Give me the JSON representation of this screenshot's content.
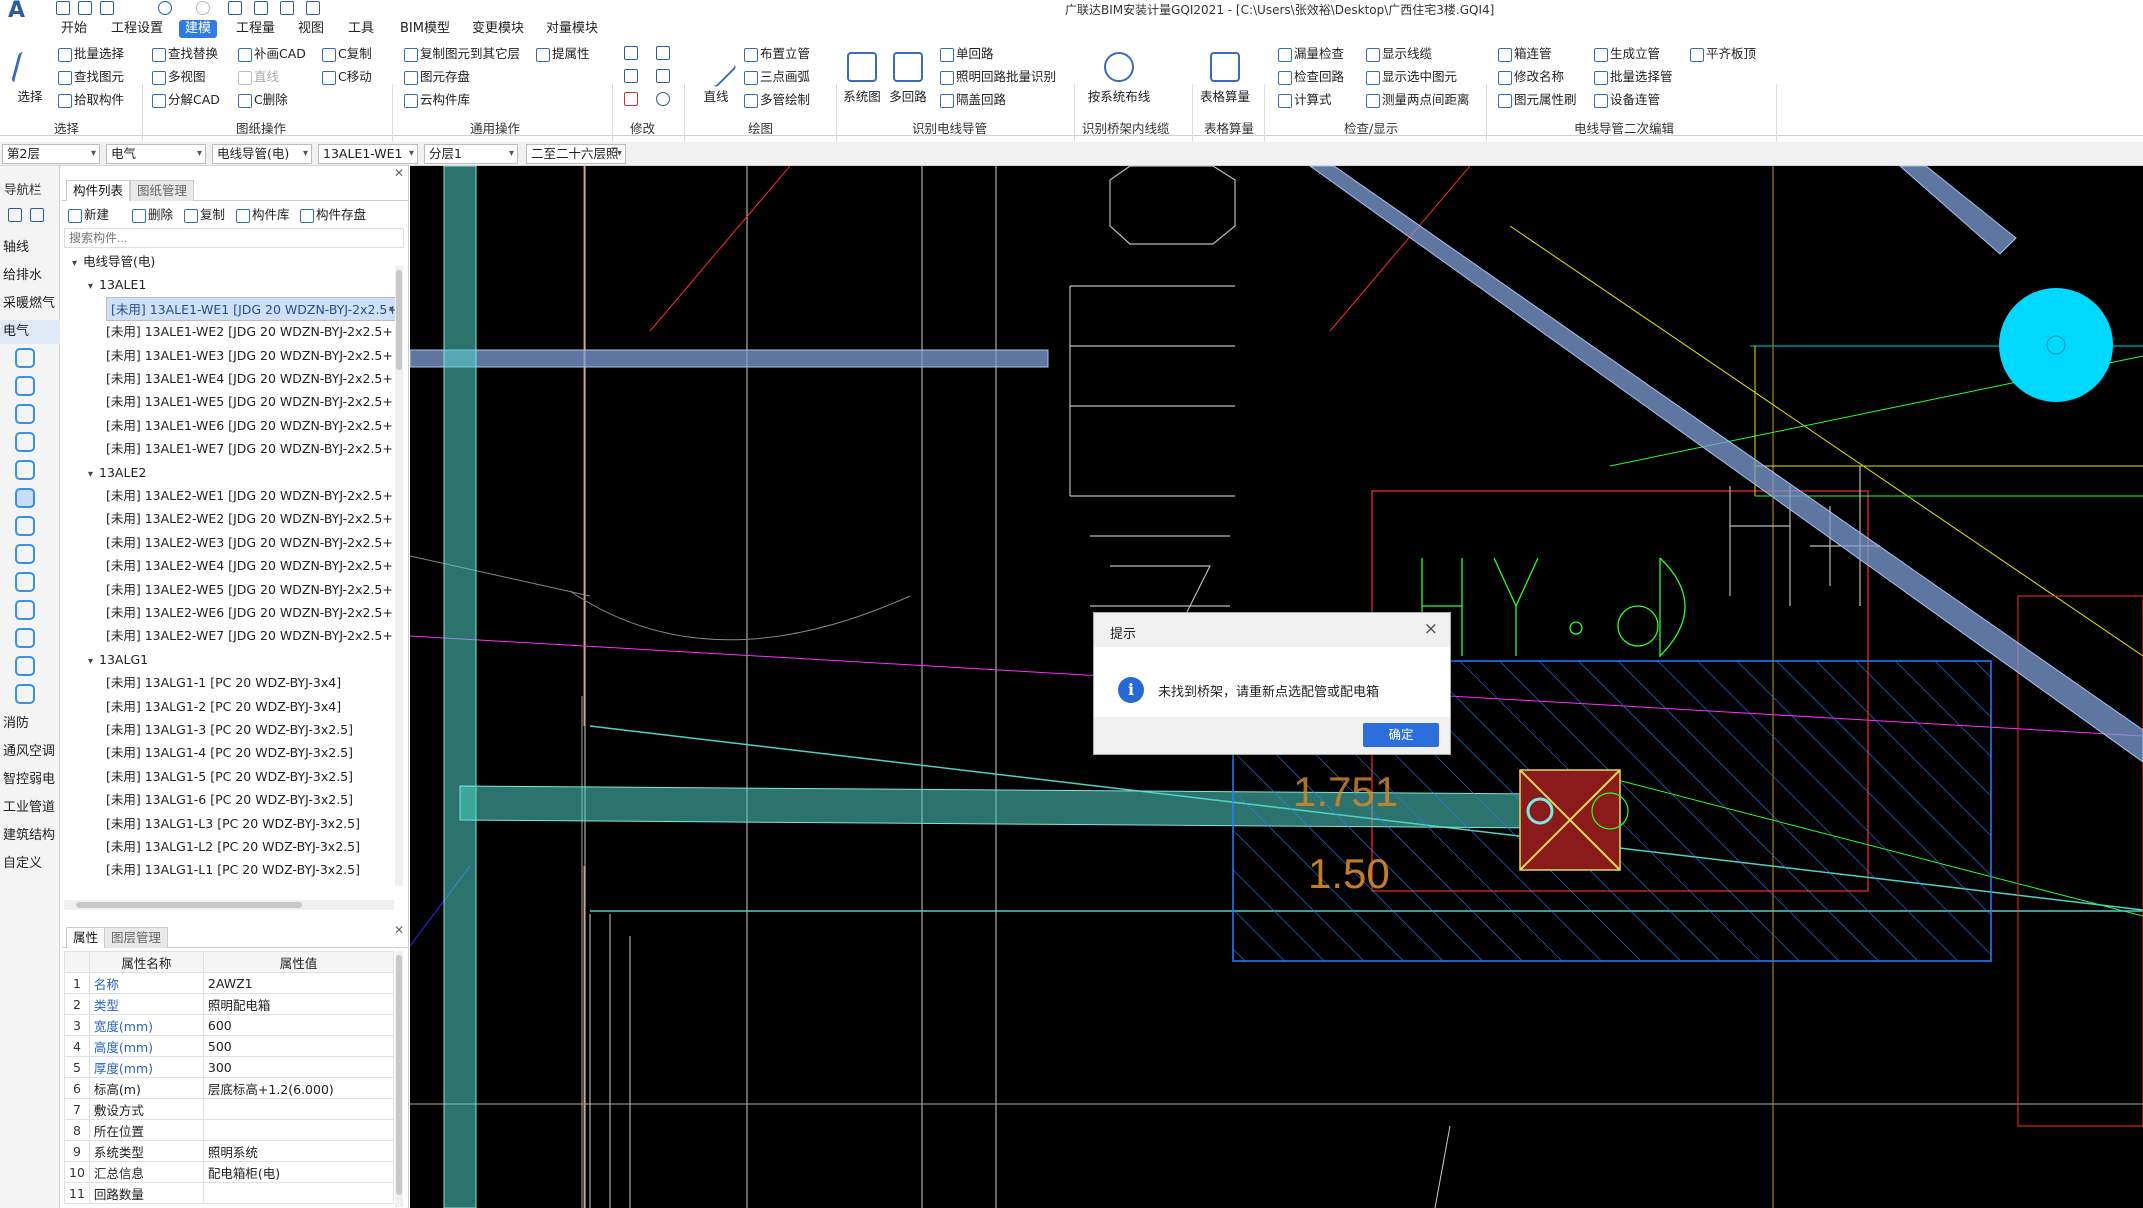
{
  "window": {
    "title": "广联达BIM安装计量GQI2021 - [C:\\Users\\张效裕\\Desktop\\广西住宅3楼.GQI4]"
  },
  "menus": [
    "开始",
    "工程设置",
    "建模",
    "工程量",
    "视图",
    "工具",
    "BIM模型",
    "变更模块",
    "对量模块"
  ],
  "ribbon": {
    "select": {
      "label": "选择",
      "items": [
        "批量选择",
        "查找图元",
        "拾取构件"
      ],
      "group": "选择"
    },
    "drawing_ops": {
      "items": [
        "查找替换",
        "多视图",
        "分解CAD",
        "补画CAD",
        "直线",
        "C复制",
        "C移动",
        "C删除"
      ],
      "group": "图纸操作"
    },
    "common_ops": {
      "items": [
        "复制图元到其它层",
        "提属性",
        "图元存盘",
        "云构件库"
      ],
      "group": "通用操作"
    },
    "modify": {
      "group": "修改"
    },
    "draw": {
      "big": "直线",
      "items": [
        "布置立管",
        "三点画弧",
        "多管绘制"
      ],
      "group": "绘图"
    },
    "identify_conduit": {
      "bigs": [
        "系统图",
        "多回路"
      ],
      "items": [
        "单回路",
        "照明回路批量识别",
        "隔盖回路"
      ],
      "group": "识别电线导管"
    },
    "identify_tray": {
      "big": "按系统布线",
      "group": "识别桥架内线缆"
    },
    "table_calc": {
      "big": "表格算量",
      "group": "表格算量"
    },
    "check_show": {
      "items": [
        "漏量检查",
        "检查回路",
        "计算式",
        "显示线缆",
        "显示选中图元",
        "测量两点间距离"
      ],
      "group": "检查/显示"
    },
    "secondary_edit": {
      "items": [
        "箱连管",
        "修改名称",
        "图元属性刷",
        "生成立管",
        "批量选择管",
        "设备连管",
        "平齐板顶"
      ],
      "group": "电线导管二次编辑"
    }
  },
  "selectors": [
    "第2层",
    "电气",
    "电线导管(电)",
    "13ALE1-WE1",
    "分层1",
    "二至二十六层照"
  ],
  "nav": {
    "title": "导航栏",
    "items": [
      "轴线",
      "给排水",
      "采暖燃气",
      "电气",
      "消防",
      "通风空调",
      "智控弱电",
      "工业管道",
      "建筑结构",
      "自定义"
    ]
  },
  "component_panel": {
    "tabs": [
      "构件列表",
      "图纸管理"
    ],
    "toolbar": [
      "新建",
      "删除",
      "复制",
      "构件库",
      "构件存盘"
    ],
    "search_placeholder": "搜索构件...",
    "tree": [
      {
        "label": "电线导管(电)",
        "level": 0,
        "header": true
      },
      {
        "label": "13ALE1",
        "level": 1,
        "header": true
      },
      {
        "label": "[未用] 13ALE1-WE1 [JDG 20 WDZN-BYJ-2x2.5+",
        "level": 2,
        "selected": true
      },
      {
        "label": "[未用] 13ALE1-WE2 [JDG 20 WDZN-BYJ-2x2.5+",
        "level": 2
      },
      {
        "label": "[未用] 13ALE1-WE3 [JDG 20 WDZN-BYJ-2x2.5+",
        "level": 2
      },
      {
        "label": "[未用] 13ALE1-WE4 [JDG 20 WDZN-BYJ-2x2.5+",
        "level": 2
      },
      {
        "label": "[未用] 13ALE1-WE5 [JDG 20 WDZN-BYJ-2x2.5+",
        "level": 2
      },
      {
        "label": "[未用] 13ALE1-WE6 [JDG 20 WDZN-BYJ-2x2.5+",
        "level": 2
      },
      {
        "label": "[未用] 13ALE1-WE7 [JDG 20 WDZN-BYJ-2x2.5+",
        "level": 2
      },
      {
        "label": "13ALE2",
        "level": 1,
        "header": true
      },
      {
        "label": "[未用] 13ALE2-WE1 [JDG 20 WDZN-BYJ-2x2.5+",
        "level": 2
      },
      {
        "label": "[未用] 13ALE2-WE2 [JDG 20 WDZN-BYJ-2x2.5+",
        "level": 2
      },
      {
        "label": "[未用] 13ALE2-WE3 [JDG 20 WDZN-BYJ-2x2.5+",
        "level": 2
      },
      {
        "label": "[未用] 13ALE2-WE4 [JDG 20 WDZN-BYJ-2x2.5+",
        "level": 2
      },
      {
        "label": "[未用] 13ALE2-WE5 [JDG 20 WDZN-BYJ-2x2.5+",
        "level": 2
      },
      {
        "label": "[未用] 13ALE2-WE6 [JDG 20 WDZN-BYJ-2x2.5+",
        "level": 2
      },
      {
        "label": "[未用] 13ALE2-WE7 [JDG 20 WDZN-BYJ-2x2.5+",
        "level": 2
      },
      {
        "label": "13ALG1",
        "level": 1,
        "header": true
      },
      {
        "label": "[未用] 13ALG1-1 [PC 20 WDZ-BYJ-3x4]",
        "level": 2
      },
      {
        "label": "[未用] 13ALG1-2 [PC 20 WDZ-BYJ-3x4]",
        "level": 2
      },
      {
        "label": "[未用] 13ALG1-3 [PC 20 WDZ-BYJ-3x2.5]",
        "level": 2
      },
      {
        "label": "[未用] 13ALG1-4 [PC 20 WDZ-BYJ-3x2.5]",
        "level": 2
      },
      {
        "label": "[未用] 13ALG1-5 [PC 20 WDZ-BYJ-3x2.5]",
        "level": 2
      },
      {
        "label": "[未用] 13ALG1-6 [PC 20 WDZ-BYJ-3x2.5]",
        "level": 2
      },
      {
        "label": "[未用] 13ALG1-L3 [PC 20 WDZ-BYJ-3x2.5]",
        "level": 2
      },
      {
        "label": "[未用] 13ALG1-L2 [PC 20 WDZ-BYJ-3x2.5]",
        "level": 2
      },
      {
        "label": "[未用] 13ALG1-L1 [PC 20 WDZ-BYJ-3x2.5]",
        "level": 2
      }
    ]
  },
  "properties": {
    "tabs": [
      "属性",
      "图层管理"
    ],
    "headers": [
      "属性名称",
      "属性值"
    ],
    "rows": [
      {
        "n": "1",
        "k": "名称",
        "v": "2AWZ1",
        "blue": true
      },
      {
        "n": "2",
        "k": "类型",
        "v": "照明配电箱",
        "blue": true
      },
      {
        "n": "3",
        "k": "宽度(mm)",
        "v": "600",
        "blue": true
      },
      {
        "n": "4",
        "k": "高度(mm)",
        "v": "500",
        "blue": true
      },
      {
        "n": "5",
        "k": "厚度(mm)",
        "v": "300",
        "blue": true
      },
      {
        "n": "6",
        "k": "标高(m)",
        "v": "层底标高+1.2(6.000)",
        "blue": false
      },
      {
        "n": "7",
        "k": "敷设方式",
        "v": "",
        "blue": false
      },
      {
        "n": "8",
        "k": "所在位置",
        "v": "",
        "blue": false
      },
      {
        "n": "9",
        "k": "系统类型",
        "v": "照明系统",
        "blue": false
      },
      {
        "n": "10",
        "k": "汇总信息",
        "v": "配电箱柜(电)",
        "blue": false
      },
      {
        "n": "11",
        "k": "回路数量",
        "v": "",
        "blue": false
      }
    ]
  },
  "canvas_text": {
    "annot1": "1.751",
    "annot2": "1.50",
    "label_hy": "HY",
    "label_d": "D"
  },
  "dialog": {
    "title": "提示",
    "message": "未找到桥架，请重新点选配管或配电箱",
    "ok": "确定",
    "close": "×",
    "info": "i"
  },
  "colors": {
    "accent": "#2e7be4",
    "canvas_bg": "#000000",
    "conduit_highlight": "#4fd1c5",
    "selection": "#3a6cb5"
  }
}
